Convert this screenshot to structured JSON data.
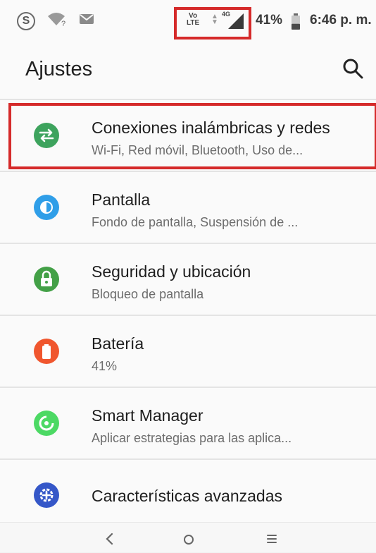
{
  "status_bar": {
    "volte_line1": "Vo",
    "volte_line2": "LTE",
    "network_type": "4G",
    "battery_percent": "41%",
    "battery_level": 0.41,
    "time": "6:46 p. m.",
    "icons": [
      "s-app-icon",
      "wifi-question-icon",
      "message-icon",
      "data-arrows-icon",
      "signal-icon",
      "battery-icon"
    ]
  },
  "app_bar": {
    "title": "Ajustes",
    "search_icon": "search-icon"
  },
  "settings": [
    {
      "title": "Conexiones inalámbricas y redes",
      "subtitle": "Wi-Fi, Red móvil, Bluetooth, Uso de...",
      "icon": "wireless-networks-icon",
      "color": "#3da35d"
    },
    {
      "title": "Pantalla",
      "subtitle": "Fondo de pantalla, Suspensión de ...",
      "icon": "display-icon",
      "color": "#2f9ee8"
    },
    {
      "title": "Seguridad y ubicación",
      "subtitle": "Bloqueo de pantalla",
      "icon": "lock-icon",
      "color": "#43a047"
    },
    {
      "title": "Batería",
      "subtitle": "41%",
      "icon": "battery-setting-icon",
      "color": "#f0562e"
    },
    {
      "title": "Smart Manager",
      "subtitle": "Aplicar estrategias para las aplica...",
      "icon": "smart-manager-icon",
      "color": "#4cd964"
    },
    {
      "title": "Características avanzadas",
      "subtitle": "",
      "icon": "advanced-features-icon",
      "color": "#3557c8"
    }
  ],
  "nav_bar": {
    "back_icon": "back-icon",
    "home_icon": "home-icon",
    "recents_icon": "recents-icon"
  },
  "highlight_color": "#d52a2a"
}
